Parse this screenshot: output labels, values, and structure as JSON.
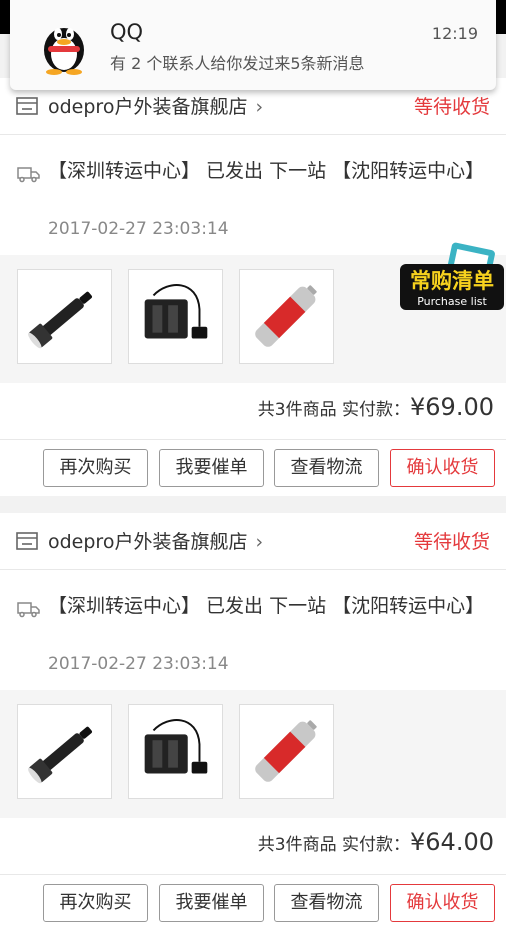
{
  "notification": {
    "app": "QQ",
    "message": "有 2 个联系人给你发过来5条新消息",
    "time": "12:19"
  },
  "badge": {
    "label": "常购清单",
    "sublabel": "Purchase list"
  },
  "orders": [
    {
      "shop": "odepro户外装备旗舰店",
      "status": "等待收货",
      "logistics": "【深圳转运中心】 已发出 下一站 【沈阳转运中心】",
      "logistics_time": "2017-02-27 23:03:14",
      "items": [
        "flashlight-thumb",
        "charger-thumb",
        "battery-thumb"
      ],
      "summary_prefix": "共3件商品 实付款：",
      "total": "¥69.00",
      "buttons": [
        "再次购买",
        "我要催单",
        "查看物流",
        "确认收货"
      ]
    },
    {
      "shop": "odepro户外装备旗舰店",
      "status": "等待收货",
      "logistics": "【深圳转运中心】 已发出 下一站 【沈阳转运中心】",
      "logistics_time": "2017-02-27 23:03:14",
      "items": [
        "flashlight-thumb",
        "charger-thumb",
        "battery-thumb"
      ],
      "summary_prefix": "共3件商品 实付款：",
      "total": "¥64.00",
      "buttons": [
        "再次购买",
        "我要催单",
        "查看物流",
        "确认收货"
      ]
    }
  ],
  "colors": {
    "accent_red": "#e4393c",
    "background": "#f2f2f2"
  }
}
